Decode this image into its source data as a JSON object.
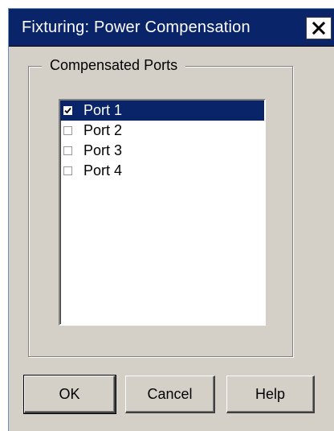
{
  "window": {
    "title": "Fixturing: Power Compensation"
  },
  "group": {
    "label": "Compensated Ports",
    "ports": [
      {
        "label": "Port 1",
        "checked": true,
        "selected": true
      },
      {
        "label": "Port 2",
        "checked": false,
        "selected": false
      },
      {
        "label": "Port 3",
        "checked": false,
        "selected": false
      },
      {
        "label": "Port 4",
        "checked": false,
        "selected": false
      }
    ]
  },
  "buttons": {
    "ok_label": "OK",
    "cancel_label": "Cancel",
    "help_label": "Help"
  },
  "colors": {
    "titlebar": "#0a246a",
    "dialog_face": "#d4d0c8",
    "selection": "#0a246a"
  },
  "icons": {
    "close": "close-icon",
    "check": "checkmark-icon"
  }
}
